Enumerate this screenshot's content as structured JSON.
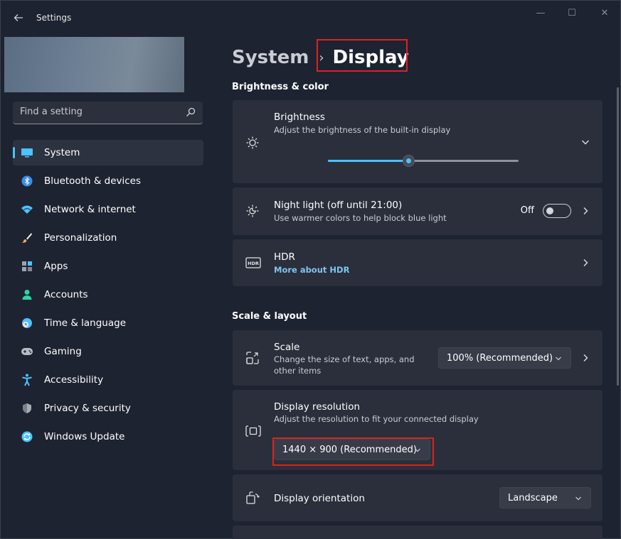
{
  "window": {
    "title": "Settings",
    "controls": {
      "minimize": "—",
      "maximize": "☐",
      "close": "✕"
    }
  },
  "search": {
    "placeholder": "Find a setting"
  },
  "sidebar": {
    "items": [
      {
        "label": "System",
        "icon": "monitor-icon",
        "color": "#4cc2ff",
        "active": true
      },
      {
        "label": "Bluetooth & devices",
        "icon": "bluetooth-icon",
        "color": "#3b8eea"
      },
      {
        "label": "Network & internet",
        "icon": "wifi-icon",
        "color": "#4cc2ff"
      },
      {
        "label": "Personalization",
        "icon": "brush-icon",
        "color": "#e8a96a"
      },
      {
        "label": "Apps",
        "icon": "apps-icon",
        "color": "#9aa3b0"
      },
      {
        "label": "Accounts",
        "icon": "person-icon",
        "color": "#2ed6a5"
      },
      {
        "label": "Time & language",
        "icon": "globe-clock-icon",
        "color": "#4cc2ff"
      },
      {
        "label": "Gaming",
        "icon": "gamepad-icon",
        "color": "#b8bcc4"
      },
      {
        "label": "Accessibility",
        "icon": "accessibility-icon",
        "color": "#4cc2ff"
      },
      {
        "label": "Privacy & security",
        "icon": "shield-icon",
        "color": "#a7acb5"
      },
      {
        "label": "Windows Update",
        "icon": "update-icon",
        "color": "#4cc2ff"
      }
    ]
  },
  "breadcrumb": {
    "parent": "System",
    "separator": "›",
    "current": "Display"
  },
  "sections": {
    "brightness_color": "Brightness & color",
    "scale_layout": "Scale & layout"
  },
  "brightness": {
    "title": "Brightness",
    "description": "Adjust the brightness of the built-in display",
    "level_percent": 42
  },
  "night_light": {
    "title": "Night light (off until 21:00)",
    "description": "Use warmer colors to help block blue light",
    "state_label": "Off"
  },
  "hdr": {
    "title": "HDR",
    "link": "More about HDR",
    "icon_text": "HDR"
  },
  "scale": {
    "title": "Scale",
    "description_line1": "Change the size of text, apps, and",
    "description_line2": "other items",
    "value": "100% (Recommended)"
  },
  "resolution": {
    "title": "Display resolution",
    "description": "Adjust the resolution to fit your connected display",
    "value": "1440 × 900 (Recommended)"
  },
  "orientation": {
    "title": "Display orientation",
    "value": "Landscape"
  },
  "colors": {
    "accent": "#4cc2ff",
    "highlight": "#e0201f",
    "link": "#7dc6f0"
  }
}
